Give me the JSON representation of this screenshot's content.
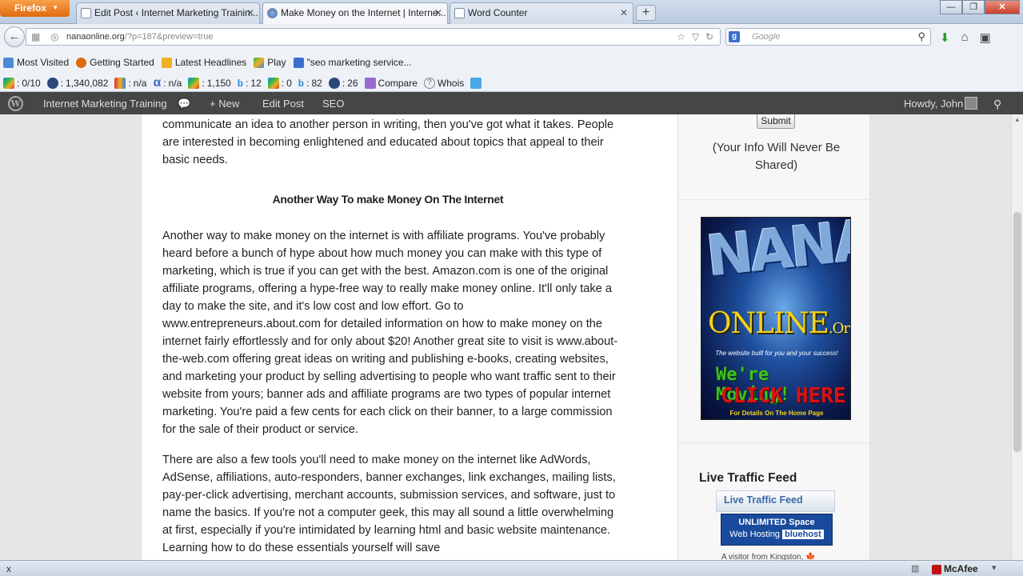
{
  "browser": {
    "app_button": "Firefox",
    "tabs": [
      {
        "label": "Edit Post ‹ Internet Marketing Trainin..."
      },
      {
        "label": "Make Money on the Internet | Interne..."
      },
      {
        "label": "Word Counter"
      }
    ],
    "new_tab": "+",
    "url_host": "nanaonline.org",
    "url_rest": "/?p=187&preview=true",
    "search_placeholder": "Google",
    "search_engine_letter": "g"
  },
  "bookmarks": [
    "Most Visited",
    "Getting Started",
    "Latest Headlines",
    "Play",
    "\"seo marketing service..."
  ],
  "seo_toolbar": {
    "pagerank": "0/10",
    "alexa": "1,340,082",
    "stat_a": "n/a",
    "stat_b": "n/a",
    "google_index": "1,150",
    "bing_index": "12",
    "google_links": "0",
    "bing_links": "82",
    "alexa_links": "26",
    "compare": "Compare",
    "whois": "Whois"
  },
  "wp_admin_bar": {
    "logo": "W",
    "site": "Internet Marketing Training",
    "new": "New",
    "new_plus": "+",
    "edit_post": "Edit Post",
    "seo": "SEO",
    "howdy": "Howdy, John"
  },
  "article": {
    "para_top": "communicate an idea to another person in writing, then you've got what it takes. People are interested in becoming enlightened and educated about topics that appeal to their basic needs.",
    "heading": "Another Way To make Money On The Internet",
    "para_1": "Another way to make money on the internet is with affiliate programs. You've probably heard before a bunch of hype about how much money you can make with this type of marketing, which is true if you can get with the best. Amazon.com is one of the original affiliate programs, offering a hype-free way to really make money online. It'll only take a day to make the site, and it's low cost and low effort. Go to www.entrepreneurs.about.com for detailed information on how to make money on the internet fairly effortlessly and for only about $20! Another great site to visit is www.about-the-web.com offering great ideas on writing and publishing e-books, creating websites, and marketing your product by selling advertising to people who want traffic sent to their website from yours; banner ads and affiliate programs are two types of popular internet marketing. You're paid a few cents for each click on their banner, to a large commission for the sale of their product or service.",
    "para_2": "There are also a few tools you'll need to make money on the internet like AdWords, AdSense, affiliations, auto-responders, banner exchanges, link exchanges, mailing lists, pay-per-click advertising, merchant accounts, submission services, and software, just to name the basics. If you're not a computer geek, this may all sound a little overwhelming at first, especially if you're intimidated by learning html and basic website maintenance. Learning how to do these essentials yourself will save"
  },
  "sidebar": {
    "submit": "Submit",
    "privacy_note": "(Your Info Will Never Be Shared)",
    "banner": {
      "brand": "NANA",
      "online": "ONLINE",
      "org": ".Org",
      "tagline": "The website built for you and your success!",
      "moving": "We're Moving!",
      "click": "CLICK HERE",
      "details": "For Details On The Home Page"
    },
    "live_traffic_title": "Live Traffic Feed",
    "live_traffic_box": "Live Traffic Feed",
    "bluehost_line1": "UNLIMITED Space",
    "bluehost_line2": "Web Hosting",
    "bluehost_brand": "bluehost",
    "visitor_text": "A visitor from Kingston,"
  },
  "statusbar": {
    "close": "x",
    "mcafee": "McAfee"
  }
}
